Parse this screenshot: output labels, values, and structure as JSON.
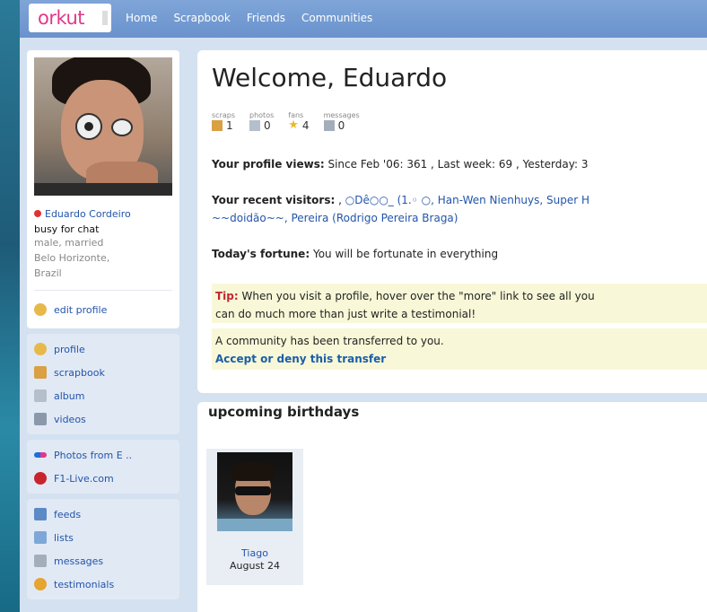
{
  "brand": {
    "logo_text": "orkut"
  },
  "nav": {
    "items": [
      "Home",
      "Scrapbook",
      "Friends",
      "Communities"
    ]
  },
  "profile": {
    "name": "Eduardo Cordeiro",
    "status": "busy for chat",
    "details": [
      "male, married",
      "Belo Horizonte,",
      "Brazil"
    ],
    "edit_label": "edit profile"
  },
  "menu1": [
    {
      "label": "profile",
      "icon": "profile-icon"
    },
    {
      "label": "scrapbook",
      "icon": "scrapbook-icon"
    },
    {
      "label": "album",
      "icon": "album-icon"
    },
    {
      "label": "videos",
      "icon": "videos-icon"
    }
  ],
  "menu2": [
    {
      "label": "Photos from E ..",
      "icon": "flickr-icon"
    },
    {
      "label": "F1-Live.com",
      "icon": "f1-icon"
    }
  ],
  "menu3": [
    {
      "label": "feeds",
      "icon": "feeds-icon"
    },
    {
      "label": "lists",
      "icon": "lists-icon"
    },
    {
      "label": "messages",
      "icon": "messages-icon"
    },
    {
      "label": "testimonials",
      "icon": "testimonials-icon"
    }
  ],
  "main": {
    "welcome": "Welcome, Eduardo",
    "stats": [
      {
        "label": "scraps",
        "value": "1"
      },
      {
        "label": "photos",
        "value": "0"
      },
      {
        "label": "fans",
        "value": "4"
      },
      {
        "label": "messages",
        "value": "0"
      }
    ],
    "profile_views_label": "Your profile views:",
    "profile_views_text": "Since Feb '06: 361 , Last week: 69 , Yesterday: 3",
    "visitors_label": "Your recent visitors:",
    "visitors_prefix": ",",
    "visitors_line1": "○Dê○○_ (1.◦ ○, Han-Wen Nienhuys, Super H",
    "visitors_line2": "~~doidão~~, Pereira (Rodrigo Pereira Braga)",
    "fortune_label": "Today's fortune:",
    "fortune_text": "You will be fortunate in everything",
    "tip_label": "Tip:",
    "tip_line1": "When you visit a profile, hover over the \"more\" link to see all you",
    "tip_line2": "can do much more than just write a testimonial!",
    "transfer_text": "A community has been transferred to you.",
    "transfer_link": "Accept or deny this transfer"
  },
  "birthdays": {
    "title": "upcoming birthdays",
    "items": [
      {
        "name": "Tiago",
        "date": "August 24"
      }
    ]
  },
  "colors": {
    "brand_pink": "#e0388c",
    "link_blue": "#2255aa",
    "topbar": "#6a92cc"
  }
}
